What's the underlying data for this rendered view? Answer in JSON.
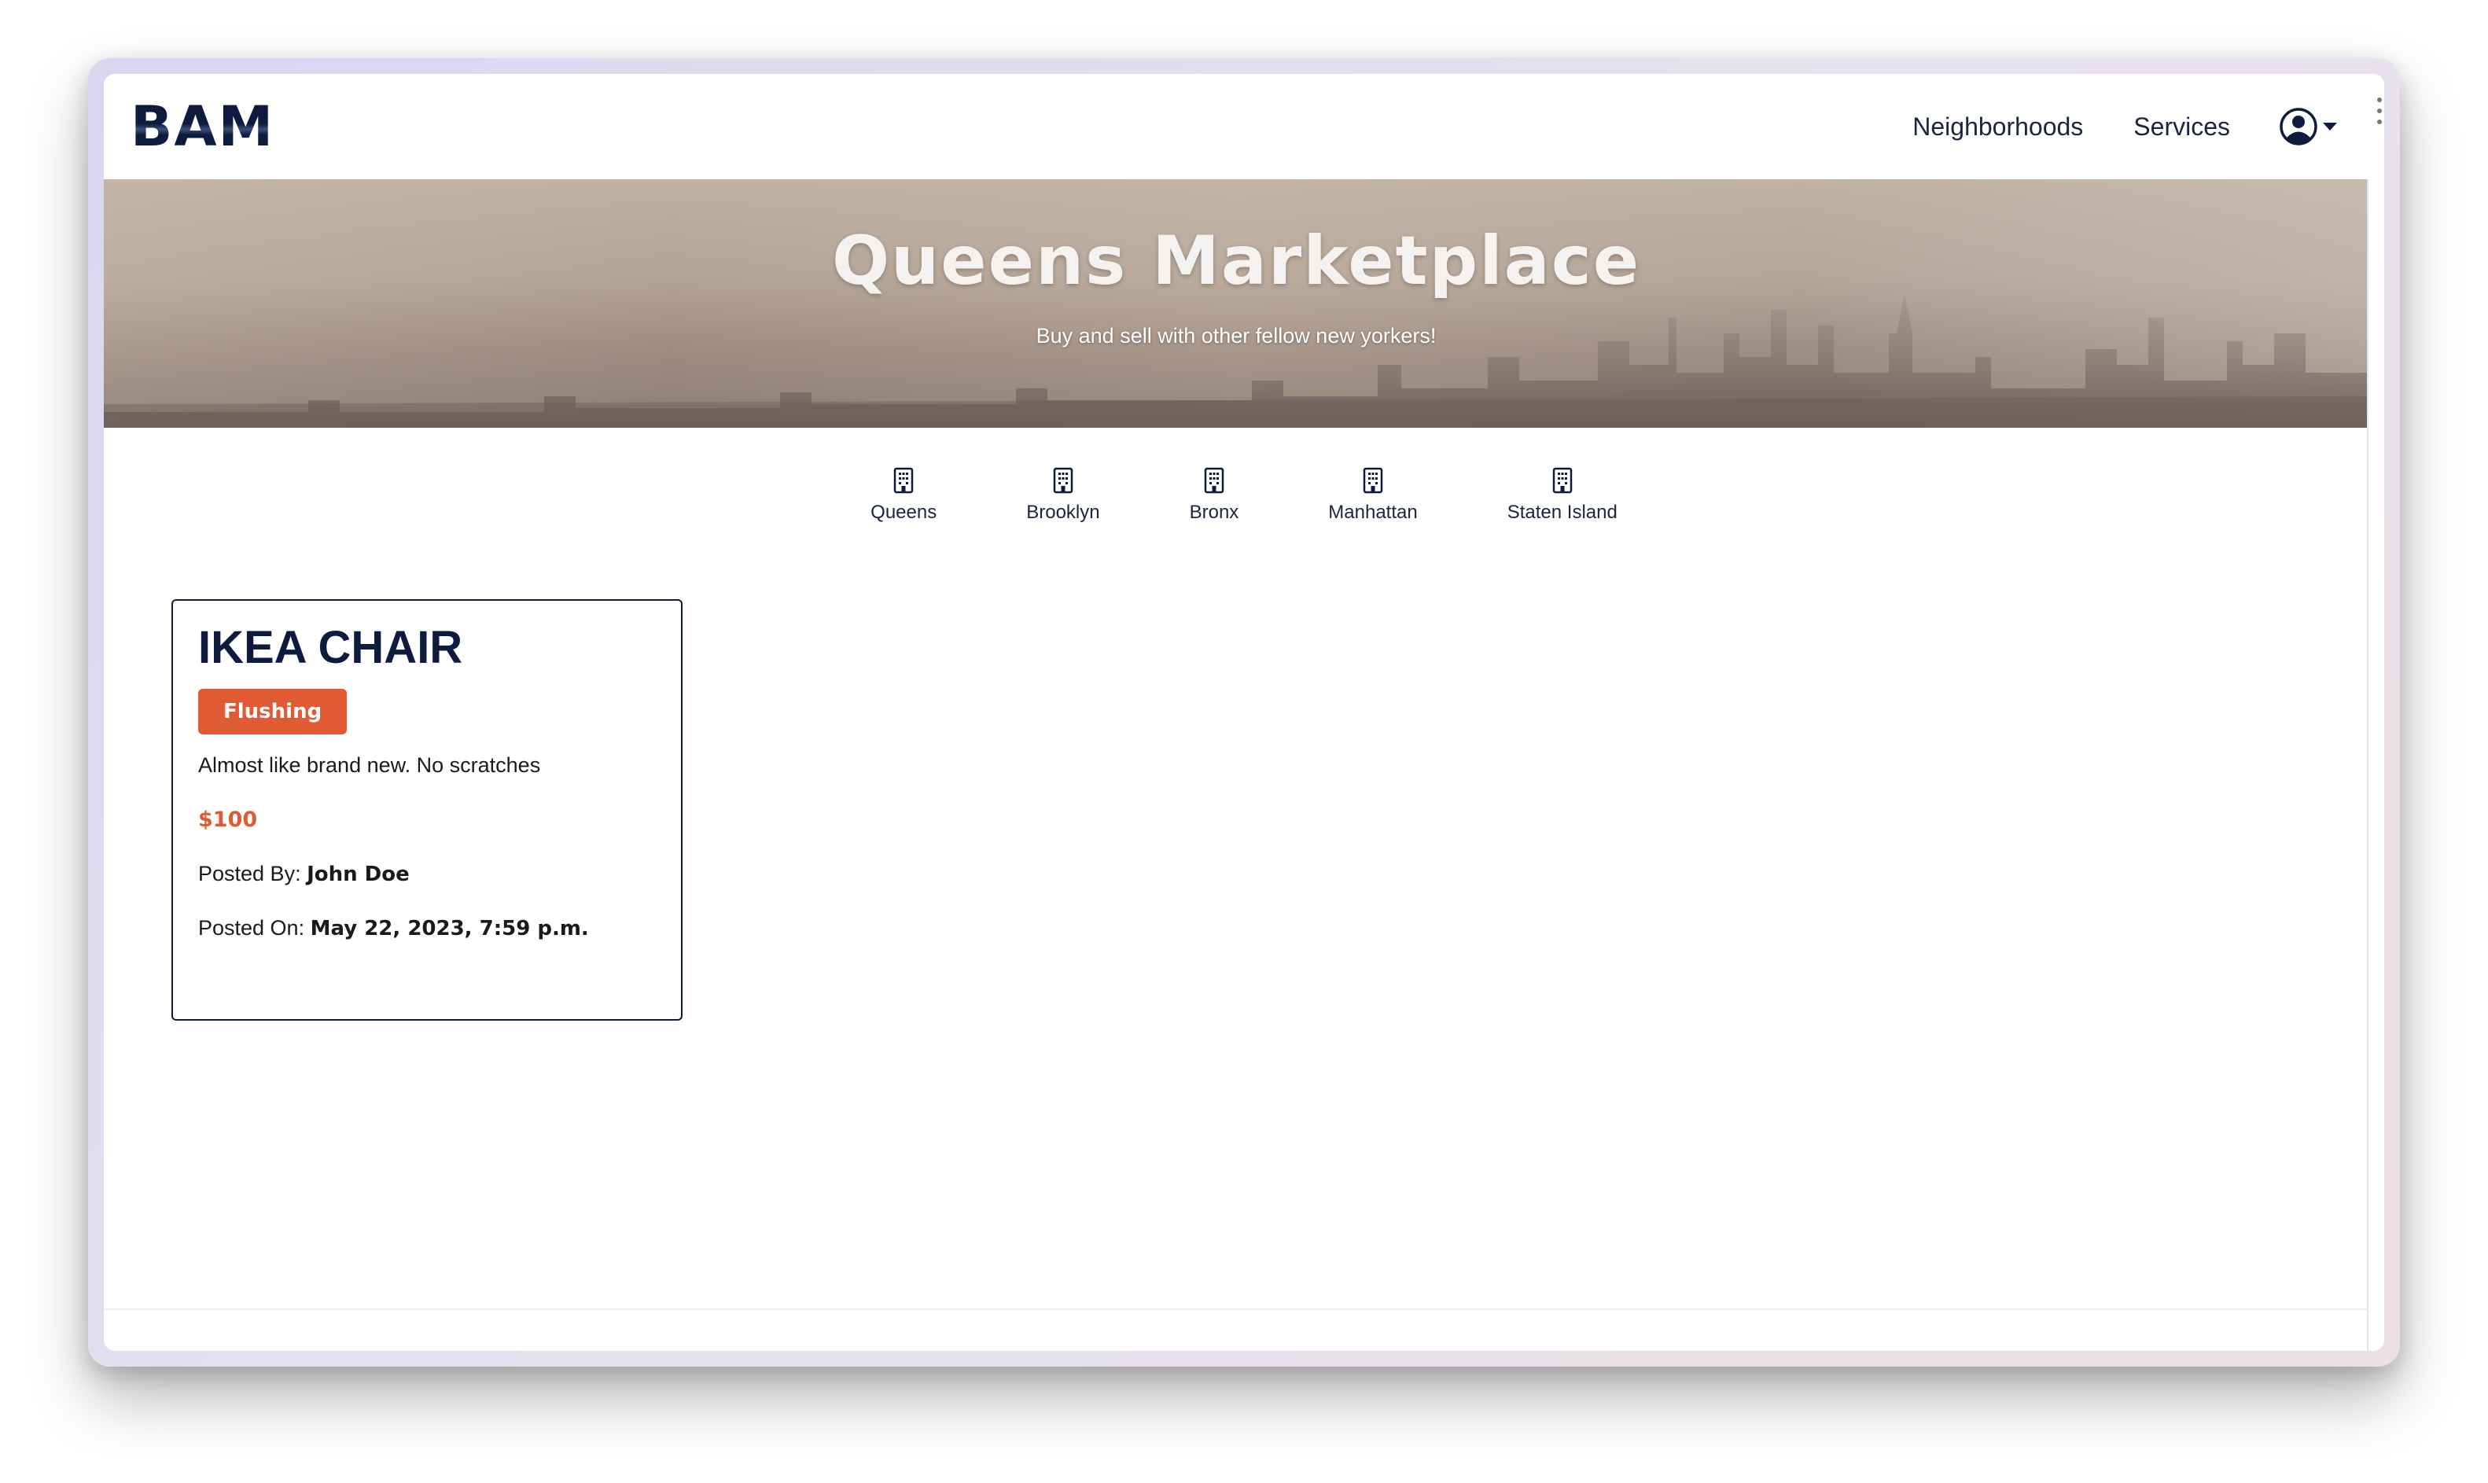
{
  "navbar": {
    "logo": "BAM",
    "links": [
      "Neighborhoods",
      "Services"
    ],
    "user_icon": "user-circle-icon"
  },
  "hero": {
    "title": "Queens Marketplace",
    "subtitle": "Buy and sell with other fellow new yorkers!"
  },
  "boroughs": [
    {
      "label": "Queens",
      "icon": "building-icon"
    },
    {
      "label": "Brooklyn",
      "icon": "building-icon"
    },
    {
      "label": "Bronx",
      "icon": "building-icon"
    },
    {
      "label": "Manhattan",
      "icon": "building-icon"
    },
    {
      "label": "Staten Island",
      "icon": "building-icon"
    }
  ],
  "listing": {
    "title": "IKEA CHAIR",
    "neighborhood": "Flushing",
    "description": "Almost like brand new. No scratches",
    "price": "$100",
    "posted_by_label": "Posted By: ",
    "posted_by": "John Doe",
    "posted_on_label": "Posted On: ",
    "posted_on": "May 22, 2023, 7:59 p.m."
  },
  "colors": {
    "navy": "#0d1b3e",
    "accent": "#e05a33"
  }
}
